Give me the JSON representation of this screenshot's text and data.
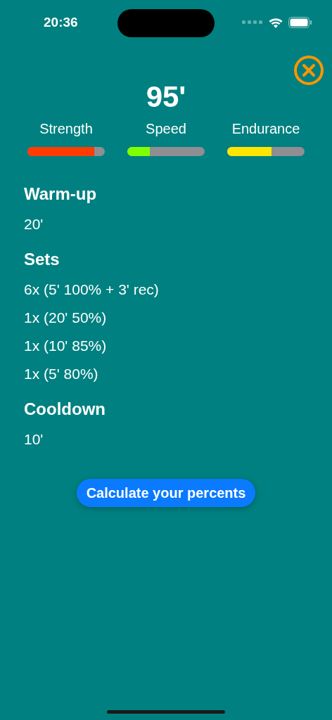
{
  "status_bar": {
    "time": "20:36"
  },
  "total": "95'",
  "meters": [
    {
      "label": "Strength",
      "level": 0.86,
      "color": "#ff3b00"
    },
    {
      "label": "Speed",
      "level": 0.29,
      "color": "#7fff00"
    },
    {
      "label": "Endurance",
      "level": 0.57,
      "color": "#ffe600"
    }
  ],
  "sections": [
    {
      "title": "Warm-up",
      "lines": [
        "20'"
      ]
    },
    {
      "title": "Sets",
      "lines": [
        "6x (5' 100% + 3' rec)",
        "1x (20' 50%)",
        "1x (10' 85%)",
        "1x (5' 80%)"
      ]
    },
    {
      "title": "Cooldown",
      "lines": [
        "10'"
      ]
    }
  ],
  "button": "Calculate your percents"
}
